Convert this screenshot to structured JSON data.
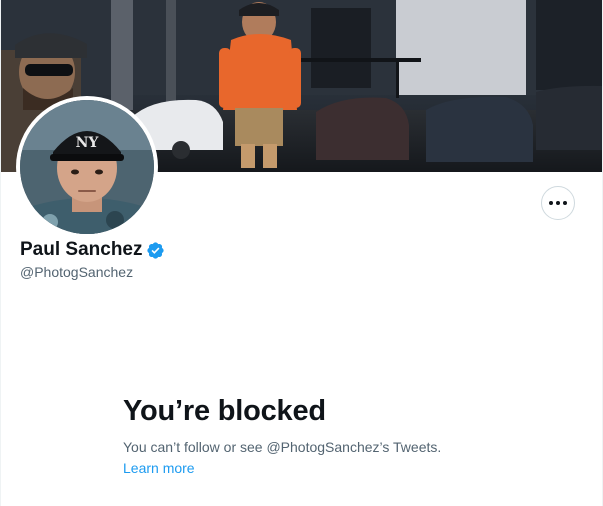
{
  "profile": {
    "name": "Paul Sanchez",
    "handle": "@PhotogSanchez",
    "verified": true
  },
  "actions": {
    "more_icon": "more-horizontal-icon"
  },
  "blocked": {
    "title": "You’re blocked",
    "description": "You can’t follow or see @PhotogSanchez’s Tweets.",
    "learn_more": "Learn more"
  },
  "colors": {
    "primary_text": "#0f1419",
    "secondary_text": "#536471",
    "link": "#1d9bf0",
    "verified_badge": "#1d9bf0",
    "border": "#cfd9de"
  }
}
